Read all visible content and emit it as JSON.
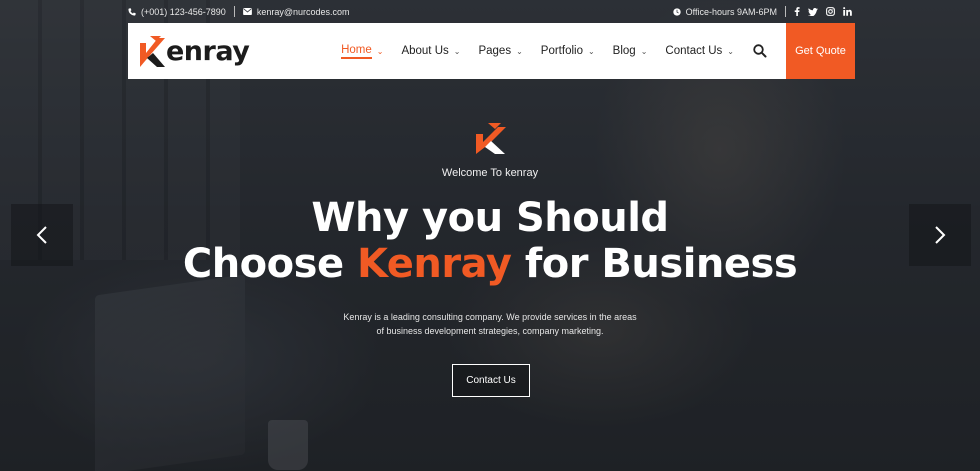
{
  "topbar": {
    "phone": "(+001) 123-456-7890",
    "email": "kenray@nurcodes.com",
    "hours": "Office-hours 9AM-6PM",
    "social": [
      "f",
      "t",
      "ig",
      "in"
    ]
  },
  "brand": {
    "name": "enray",
    "accent_color": "#f15a24"
  },
  "nav": {
    "items": [
      {
        "label": "Home",
        "active": true
      },
      {
        "label": "About Us"
      },
      {
        "label": "Pages"
      },
      {
        "label": "Portfolio"
      },
      {
        "label": "Blog"
      },
      {
        "label": "Contact Us"
      }
    ],
    "quote_label": "Get Quote",
    "search_icon": "search-icon"
  },
  "hero": {
    "welcome": "Welcome To kenray",
    "headline_line1": "Why you Should",
    "headline_line2_pre": "Choose ",
    "headline_line2_accent": "Kenray",
    "headline_line2_post": " for Business",
    "description": "Kenray is a leading consulting company. We provide services in the areas of business development strategies, company marketing.",
    "cta_label": "Contact Us"
  },
  "slider": {
    "prev_icon": "chevron-left-icon",
    "next_icon": "chevron-right-icon"
  }
}
